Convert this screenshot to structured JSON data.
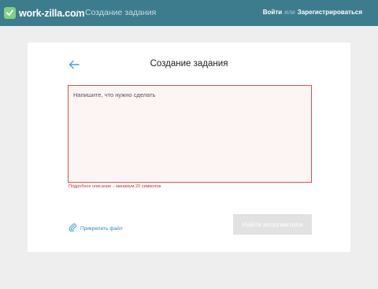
{
  "header": {
    "logo_text": "work-zilla.com",
    "breadcrumb_separator": "/",
    "breadcrumb_current": "Создание задания",
    "login_label": "Войти",
    "or_label": "или",
    "register_label": "Зарегистрироваться",
    "bg_color": "#3d7c8c"
  },
  "form": {
    "title": "Создание задания",
    "textarea_placeholder": "Напишите, что нужно сделать",
    "textarea_value": "",
    "error_message": "Подробное описание – минимум 20 символов",
    "attach_label": "Прикрепить файл",
    "submit_label": "Найти исполнителя",
    "back_icon": "arrow-left-icon",
    "attach_icon": "paperclip-icon"
  }
}
